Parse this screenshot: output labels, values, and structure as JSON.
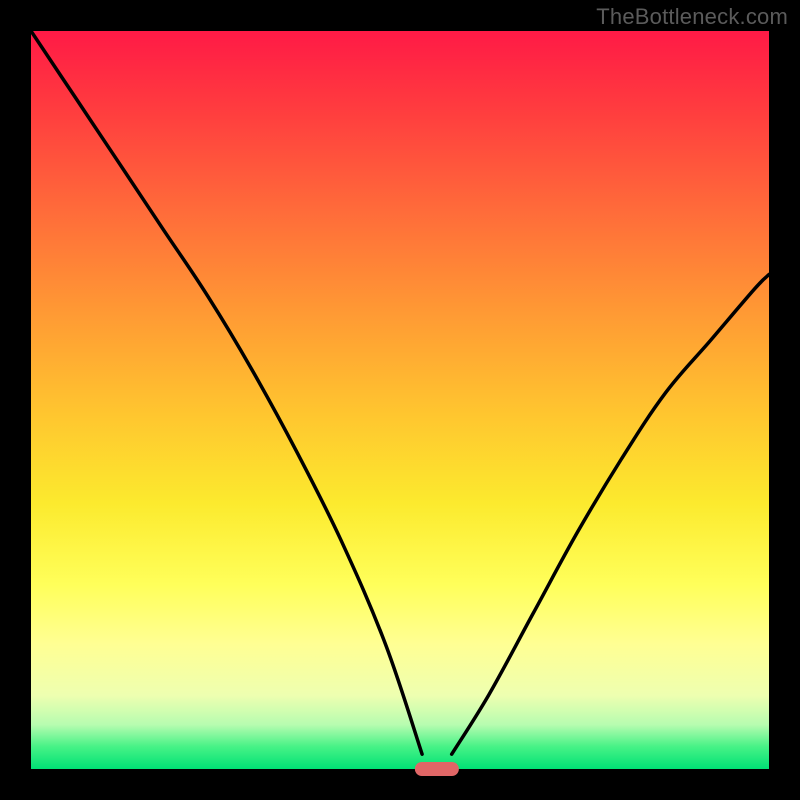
{
  "attribution": "TheBottleneck.com",
  "chart_data": {
    "type": "line",
    "title": "",
    "xlabel": "",
    "ylabel": "",
    "xlim": [
      0,
      100
    ],
    "ylim": [
      0,
      100
    ],
    "grid": false,
    "legend": false,
    "series": [
      {
        "name": "left-curve",
        "x": [
          0,
          6,
          12,
          18,
          24,
          30,
          36,
          42,
          48,
          53
        ],
        "values": [
          100,
          91,
          82,
          73,
          64,
          54,
          43,
          31,
          17,
          2
        ]
      },
      {
        "name": "right-curve",
        "x": [
          57,
          62,
          68,
          74,
          80,
          86,
          92,
          98,
          100
        ],
        "values": [
          2,
          10,
          21,
          32,
          42,
          51,
          58,
          65,
          67
        ]
      }
    ],
    "marker": {
      "x": 55,
      "y": 0,
      "width_pct": 6
    },
    "background_gradient": {
      "top": "#ff1a46",
      "bottom": "#00e175"
    }
  }
}
